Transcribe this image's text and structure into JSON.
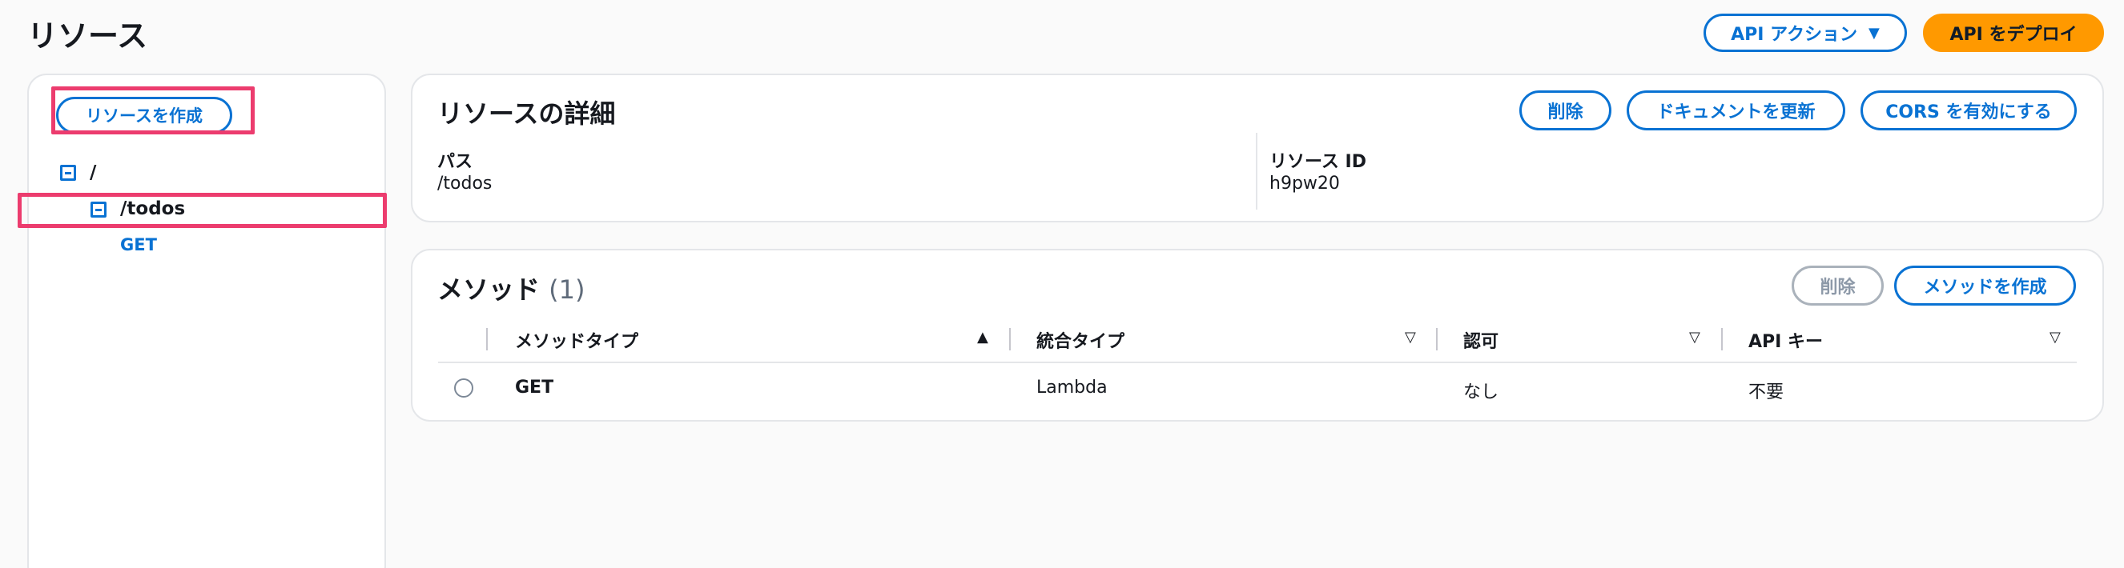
{
  "page": {
    "title": "リソース",
    "api_actions_label": "API アクション",
    "deploy_label": "API をデプロイ"
  },
  "sidebar": {
    "create_resource_label": "リソースを作成",
    "tree": [
      {
        "label": "/",
        "expanded": true
      },
      {
        "label": "/todos",
        "expanded": true,
        "selected": true
      },
      {
        "label": "GET",
        "type": "method"
      }
    ]
  },
  "details": {
    "title": "リソースの詳細",
    "delete_label": "削除",
    "update_docs_label": "ドキュメントを更新",
    "enable_cors_label": "CORS を有効にする",
    "path_label": "パス",
    "path_value": "/todos",
    "resource_id_label": "リソース ID",
    "resource_id_value": "h9pw20"
  },
  "methods": {
    "title": "メソッド",
    "count": "(1)",
    "delete_label": "削除",
    "create_label": "メソッドを作成",
    "columns": [
      "メソッドタイプ",
      "統合タイプ",
      "認可",
      "API キー"
    ],
    "rows": [
      {
        "method": "GET",
        "integration": "Lambda",
        "authorization": "なし",
        "api_key": "不要"
      }
    ]
  },
  "colors": {
    "accent": "#0972d3",
    "primary": "#ff9900",
    "highlight": "#ec3c6e"
  }
}
